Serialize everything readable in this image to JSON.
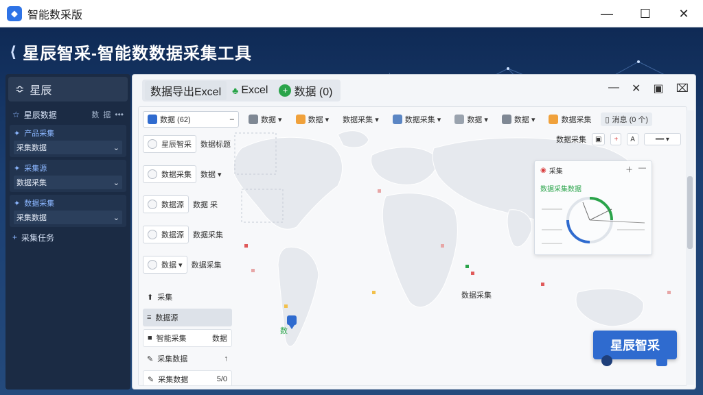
{
  "window": {
    "title": "智能数采版",
    "controls": {
      "minimize": "—",
      "maximize": "☐",
      "close": "✕"
    }
  },
  "banner": {
    "back_glyph": "⟨",
    "title": "星辰智采-智能数数据采集工具"
  },
  "sidebar": {
    "header": {
      "icon": "≎",
      "label": "星辰"
    },
    "root": {
      "icon": "☆",
      "label": "星辰数据",
      "right1": "数",
      "right2": "据"
    },
    "groups": [
      {
        "title": "产品采集",
        "value": "采集数据"
      },
      {
        "title": "采集源",
        "value": "数据采集"
      },
      {
        "title": "数据采集",
        "value": "采集数据"
      }
    ],
    "footer": {
      "icon": "+",
      "label": "采集任务"
    }
  },
  "panel": {
    "tabs": [
      {
        "label": "数据导出Excel"
      },
      {
        "icon": "excel-icon",
        "label": "Excel"
      },
      {
        "icon": "plus-circle-icon",
        "label": "数据 (0)"
      }
    ],
    "controls": {
      "minus": "—",
      "close": "✕",
      "chat": "▣",
      "pin": "⌧"
    },
    "toolbar": {
      "main_dropdown": "数据 (62)",
      "items": [
        "数据 ▾",
        "数据 ▾",
        "数据采集 ▾",
        "数据采集 ▾",
        "数据 ▾",
        "数据 ▾",
        "数据采集"
      ],
      "tab_last": "消息 (0 个)"
    },
    "filters": [
      {
        "label": "星辰智采",
        "tail": "数据标题"
      },
      {
        "label": "数据采集",
        "tail": "数据 ▾"
      },
      {
        "label": "数据源",
        "tail": "数据 采"
      },
      {
        "label": "数据源",
        "tail": "数据采集"
      },
      {
        "label": "数据 ▾",
        "tail": "数据采集"
      }
    ],
    "list_header": "采集",
    "list": [
      {
        "label": "数据源",
        "tail": ""
      },
      {
        "label": "智能采集",
        "tail": "数据"
      },
      {
        "label": "采集数据",
        "tail": "↑"
      },
      {
        "label": "采集数据",
        "tail": "5/0"
      }
    ],
    "map": {
      "label_africa": "数据采集",
      "label_sa": "数"
    },
    "map_tools": {
      "label": "数据采集",
      "btn_plus": "+",
      "btn_a": "A"
    },
    "overlay": {
      "title": "采集",
      "subtitle": "数据采集数据",
      "right": [
        "＋",
        "—"
      ]
    },
    "brand_button": "星辰智采"
  },
  "colors": {
    "accent": "#2f6bcf",
    "green": "#27a447",
    "sidebar_bg": "#1b2b44",
    "banner_top": "#0f2a55"
  }
}
